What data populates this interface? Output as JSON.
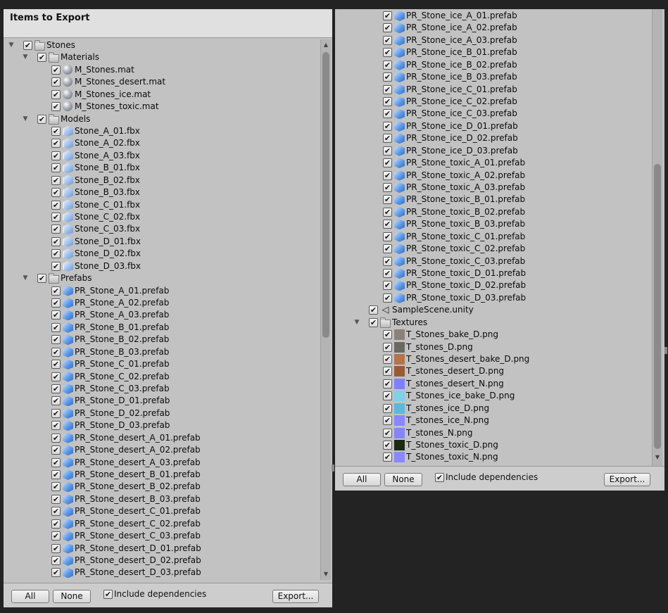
{
  "left": {
    "title": "Items to Export",
    "rows": [
      {
        "label": "Stones",
        "depth": 0,
        "expandable": true,
        "icon": "folder"
      },
      {
        "label": "Materials",
        "depth": 1,
        "expandable": true,
        "icon": "folder"
      },
      {
        "label": "M_Stones.mat",
        "depth": 2,
        "icon": "material"
      },
      {
        "label": "M_Stones_desert.mat",
        "depth": 2,
        "icon": "material"
      },
      {
        "label": "M_Stones_ice.mat",
        "depth": 2,
        "icon": "material"
      },
      {
        "label": "M_Stones_toxic.mat",
        "depth": 2,
        "icon": "material"
      },
      {
        "label": "Models",
        "depth": 1,
        "expandable": true,
        "icon": "folder"
      },
      {
        "label": "Stone_A_01.fbx",
        "depth": 2,
        "icon": "model"
      },
      {
        "label": "Stone_A_02.fbx",
        "depth": 2,
        "icon": "model"
      },
      {
        "label": "Stone_A_03.fbx",
        "depth": 2,
        "icon": "model"
      },
      {
        "label": "Stone_B_01.fbx",
        "depth": 2,
        "icon": "model"
      },
      {
        "label": "Stone_B_02.fbx",
        "depth": 2,
        "icon": "model"
      },
      {
        "label": "Stone_B_03.fbx",
        "depth": 2,
        "icon": "model"
      },
      {
        "label": "Stone_C_01.fbx",
        "depth": 2,
        "icon": "model"
      },
      {
        "label": "Stone_C_02.fbx",
        "depth": 2,
        "icon": "model"
      },
      {
        "label": "Stone_C_03.fbx",
        "depth": 2,
        "icon": "model"
      },
      {
        "label": "Stone_D_01.fbx",
        "depth": 2,
        "icon": "model"
      },
      {
        "label": "Stone_D_02.fbx",
        "depth": 2,
        "icon": "model"
      },
      {
        "label": "Stone_D_03.fbx",
        "depth": 2,
        "icon": "model"
      },
      {
        "label": "Prefabs",
        "depth": 1,
        "expandable": true,
        "icon": "folder"
      },
      {
        "label": "PR_Stone_A_01.prefab",
        "depth": 2,
        "icon": "prefab"
      },
      {
        "label": "PR_Stone_A_02.prefab",
        "depth": 2,
        "icon": "prefab"
      },
      {
        "label": "PR_Stone_A_03.prefab",
        "depth": 2,
        "icon": "prefab"
      },
      {
        "label": "PR_Stone_B_01.prefab",
        "depth": 2,
        "icon": "prefab"
      },
      {
        "label": "PR_Stone_B_02.prefab",
        "depth": 2,
        "icon": "prefab"
      },
      {
        "label": "PR_Stone_B_03.prefab",
        "depth": 2,
        "icon": "prefab"
      },
      {
        "label": "PR_Stone_C_01.prefab",
        "depth": 2,
        "icon": "prefab"
      },
      {
        "label": "PR_Stone_C_02.prefab",
        "depth": 2,
        "icon": "prefab"
      },
      {
        "label": "PR_Stone_C_03.prefab",
        "depth": 2,
        "icon": "prefab"
      },
      {
        "label": "PR_Stone_D_01.prefab",
        "depth": 2,
        "icon": "prefab"
      },
      {
        "label": "PR_Stone_D_02.prefab",
        "depth": 2,
        "icon": "prefab"
      },
      {
        "label": "PR_Stone_D_03.prefab",
        "depth": 2,
        "icon": "prefab"
      },
      {
        "label": "PR_Stone_desert_A_01.prefab",
        "depth": 2,
        "icon": "prefab"
      },
      {
        "label": "PR_Stone_desert_A_02.prefab",
        "depth": 2,
        "icon": "prefab"
      },
      {
        "label": "PR_Stone_desert_A_03.prefab",
        "depth": 2,
        "icon": "prefab"
      },
      {
        "label": "PR_Stone_desert_B_01.prefab",
        "depth": 2,
        "icon": "prefab"
      },
      {
        "label": "PR_Stone_desert_B_02.prefab",
        "depth": 2,
        "icon": "prefab"
      },
      {
        "label": "PR_Stone_desert_B_03.prefab",
        "depth": 2,
        "icon": "prefab"
      },
      {
        "label": "PR_Stone_desert_C_01.prefab",
        "depth": 2,
        "icon": "prefab"
      },
      {
        "label": "PR_Stone_desert_C_02.prefab",
        "depth": 2,
        "icon": "prefab"
      },
      {
        "label": "PR_Stone_desert_C_03.prefab",
        "depth": 2,
        "icon": "prefab"
      },
      {
        "label": "PR_Stone_desert_D_01.prefab",
        "depth": 2,
        "icon": "prefab"
      },
      {
        "label": "PR_Stone_desert_D_02.prefab",
        "depth": 2,
        "icon": "prefab"
      },
      {
        "label": "PR_Stone_desert_D_03.prefab",
        "depth": 2,
        "icon": "prefab"
      }
    ],
    "footer": {
      "all_label": "All",
      "none_label": "None",
      "deps_label": "Include dependencies",
      "export_label": "Export..."
    }
  },
  "right": {
    "rows": [
      {
        "label": "PR_Stone_ice_A_01.prefab",
        "depth": 2,
        "icon": "prefab"
      },
      {
        "label": "PR_Stone_ice_A_02.prefab",
        "depth": 2,
        "icon": "prefab"
      },
      {
        "label": "PR_Stone_ice_A_03.prefab",
        "depth": 2,
        "icon": "prefab"
      },
      {
        "label": "PR_Stone_ice_B_01.prefab",
        "depth": 2,
        "icon": "prefab"
      },
      {
        "label": "PR_Stone_ice_B_02.prefab",
        "depth": 2,
        "icon": "prefab"
      },
      {
        "label": "PR_Stone_ice_B_03.prefab",
        "depth": 2,
        "icon": "prefab"
      },
      {
        "label": "PR_Stone_ice_C_01.prefab",
        "depth": 2,
        "icon": "prefab"
      },
      {
        "label": "PR_Stone_ice_C_02.prefab",
        "depth": 2,
        "icon": "prefab"
      },
      {
        "label": "PR_Stone_ice_C_03.prefab",
        "depth": 2,
        "icon": "prefab"
      },
      {
        "label": "PR_Stone_ice_D_01.prefab",
        "depth": 2,
        "icon": "prefab"
      },
      {
        "label": "PR_Stone_ice_D_02.prefab",
        "depth": 2,
        "icon": "prefab"
      },
      {
        "label": "PR_Stone_ice_D_03.prefab",
        "depth": 2,
        "icon": "prefab"
      },
      {
        "label": "PR_Stone_toxic_A_01.prefab",
        "depth": 2,
        "icon": "prefab"
      },
      {
        "label": "PR_Stone_toxic_A_02.prefab",
        "depth": 2,
        "icon": "prefab"
      },
      {
        "label": "PR_Stone_toxic_A_03.prefab",
        "depth": 2,
        "icon": "prefab"
      },
      {
        "label": "PR_Stone_toxic_B_01.prefab",
        "depth": 2,
        "icon": "prefab"
      },
      {
        "label": "PR_Stone_toxic_B_02.prefab",
        "depth": 2,
        "icon": "prefab"
      },
      {
        "label": "PR_Stone_toxic_B_03.prefab",
        "depth": 2,
        "icon": "prefab"
      },
      {
        "label": "PR_Stone_toxic_C_01.prefab",
        "depth": 2,
        "icon": "prefab"
      },
      {
        "label": "PR_Stone_toxic_C_02.prefab",
        "depth": 2,
        "icon": "prefab"
      },
      {
        "label": "PR_Stone_toxic_C_03.prefab",
        "depth": 2,
        "icon": "prefab"
      },
      {
        "label": "PR_Stone_toxic_D_01.prefab",
        "depth": 2,
        "icon": "prefab"
      },
      {
        "label": "PR_Stone_toxic_D_02.prefab",
        "depth": 2,
        "icon": "prefab"
      },
      {
        "label": "PR_Stone_toxic_D_03.prefab",
        "depth": 2,
        "icon": "prefab"
      },
      {
        "label": "SampleScene.unity",
        "depth": 1,
        "icon": "unity-scene"
      },
      {
        "label": "Textures",
        "depth": 1,
        "expandable": true,
        "icon": "folder"
      },
      {
        "label": "T_Stones_bake_D.png",
        "depth": 2,
        "icon": "texture",
        "swatch": "#8a8276"
      },
      {
        "label": "T_stones_D.png",
        "depth": 2,
        "icon": "texture",
        "swatch": "#6b6864"
      },
      {
        "label": "T_Stones_desert_bake_D.png",
        "depth": 2,
        "icon": "texture",
        "swatch": "#b5744a"
      },
      {
        "label": "T_stones_desert_D.png",
        "depth": 2,
        "icon": "texture",
        "swatch": "#9a5a36"
      },
      {
        "label": "T_stones_desert_N.png",
        "depth": 2,
        "icon": "texture",
        "swatch": "#8080ff"
      },
      {
        "label": "T_Stones_ice_bake_D.png",
        "depth": 2,
        "icon": "texture",
        "swatch": "#7fd0e8"
      },
      {
        "label": "T_stones_ice_D.png",
        "depth": 2,
        "icon": "texture",
        "swatch": "#5fb8d8"
      },
      {
        "label": "T_stones_ice_N.png",
        "depth": 2,
        "icon": "texture",
        "swatch": "#8a86ff"
      },
      {
        "label": "T_stones_N.png",
        "depth": 2,
        "icon": "texture",
        "swatch": "#8484fc"
      },
      {
        "label": "T_Stones_toxic_D.png",
        "depth": 2,
        "icon": "texture",
        "swatch": "#1c2a12"
      },
      {
        "label": "T_Stones_toxic_N.png",
        "depth": 2,
        "icon": "texture",
        "swatch": "#8888ff"
      }
    ],
    "footer": {
      "all_label": "All",
      "none_label": "None",
      "deps_label": "Include dependencies",
      "export_label": "Export..."
    }
  },
  "checkmark_glyph": "✔",
  "expand_glyph": "▼",
  "scroll_up_glyph": "▲",
  "scroll_down_glyph": "▼",
  "unity_glyph": "◁",
  "colors": {
    "panel_bg": "#c2c2c2",
    "header_bg": "#e0e0e0",
    "window_bg": "#232323",
    "prefab_blue": "#5f9ae6"
  }
}
